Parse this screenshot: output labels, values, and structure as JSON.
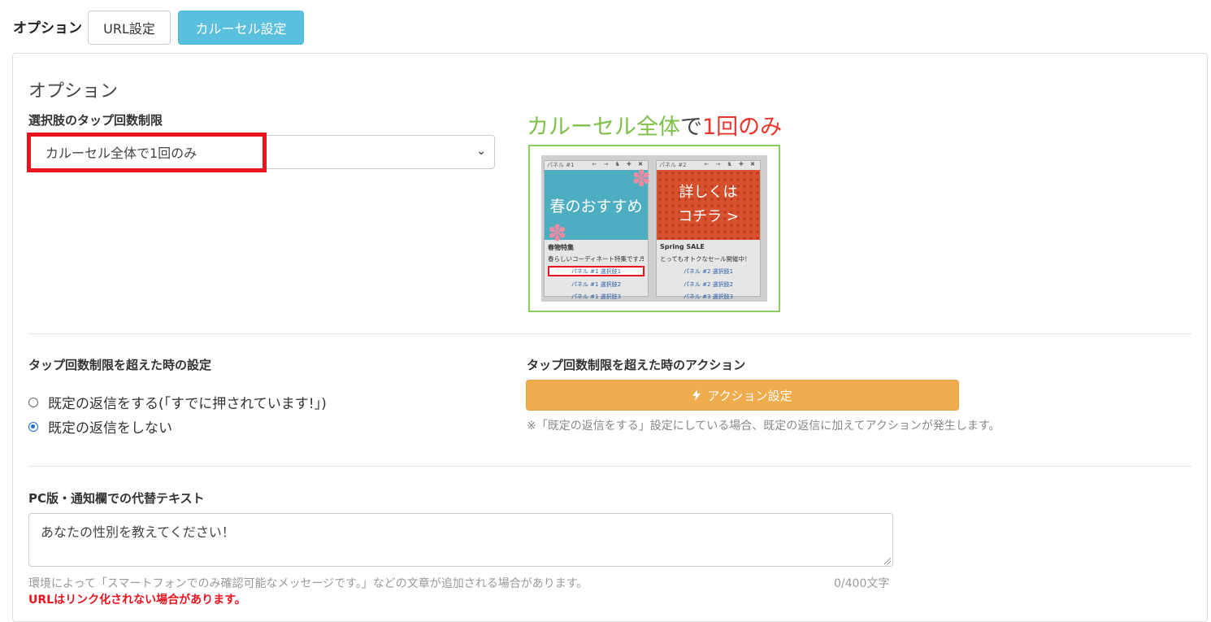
{
  "topbar": {
    "label": "オプション",
    "tabs": [
      {
        "label": "URL設定",
        "active": false
      },
      {
        "label": "カルーセル設定",
        "active": true
      }
    ]
  },
  "options": {
    "title": "オプション",
    "tap_limit": {
      "label": "選択肢のタップ回数制限",
      "selected": "カルーセル全体で1回のみ"
    },
    "preview": {
      "heading_part1": "カルーセル全体",
      "heading_part2": "で",
      "heading_part3": "1回のみ",
      "cards": [
        {
          "header": "パネル #1",
          "controls": "← → ♞ ✚ ✖",
          "image_text": "春のおすすめ",
          "title": "春物特集",
          "text": "春らしいコーディネート特集です♬",
          "options": [
            "パネル #1 選択肢1",
            "パネル #1 選択肢2",
            "パネル #1 選択肢3"
          ]
        },
        {
          "header": "パネル #2",
          "controls": "← → ♞ ✚ ✖",
          "image_line1": "詳しくは",
          "image_line2": "コチラ >",
          "title": "Spring SALE",
          "text": "とってもオトクなセール開催中！",
          "options": [
            "パネル #2 選択肢1",
            "パネル #2 選択肢2",
            "パネル #3 選択肢3"
          ]
        }
      ]
    },
    "exceed_setting": {
      "label": "タップ回数制限を超えた時の設定",
      "radios": [
        {
          "label": "既定の返信をする(「すでに押されています!」)",
          "checked": false
        },
        {
          "label": "既定の返信をしない",
          "checked": true
        }
      ]
    },
    "exceed_action": {
      "label": "タップ回数制限を超えた時のアクション",
      "button_icon": "bolt-icon",
      "button_label": "アクション設定",
      "note": "※「既定の返信をする」設定にしている場合、既定の返信に加えてアクションが発生します。"
    },
    "alt_text": {
      "label": "PC版・通知欄での代替テキスト",
      "value": "あなたの性別を教えてください！",
      "help": "環境によって「スマートフォンでのみ確認可能なメッセージです。」などの文章が追加される場合があります。",
      "counter": "0/400文字",
      "warning": "URLはリンク化されない場合があります。"
    }
  },
  "colors": {
    "tab_active": "#5bc0de",
    "action_button": "#f0ad4e",
    "highlight_red": "#e8141e",
    "heading_green": "#7ec04a"
  }
}
